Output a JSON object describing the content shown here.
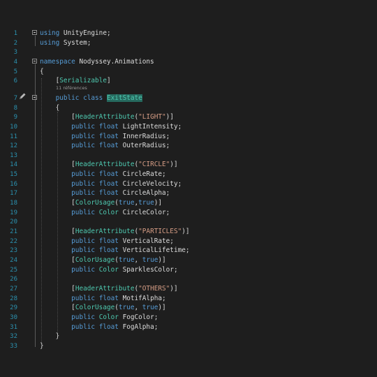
{
  "editor": {
    "references_label": "11 références",
    "lines": [
      {
        "n": "1",
        "tokens": [
          {
            "t": "using",
            "c": "kw"
          },
          {
            "t": " UnityEngine;",
            "c": "id"
          }
        ]
      },
      {
        "n": "2",
        "tokens": [
          {
            "t": "using",
            "c": "kw"
          },
          {
            "t": " System;",
            "c": "id"
          }
        ]
      },
      {
        "n": "3",
        "tokens": []
      },
      {
        "n": "4",
        "tokens": [
          {
            "t": "namespace",
            "c": "kw"
          },
          {
            "t": " Nodyssey.Animations",
            "c": "id"
          }
        ]
      },
      {
        "n": "5",
        "tokens": [
          {
            "t": "{",
            "c": "pun"
          }
        ]
      },
      {
        "n": "6",
        "tokens": [
          {
            "t": "    [",
            "c": "pun"
          },
          {
            "t": "Serializable",
            "c": "ty"
          },
          {
            "t": "]",
            "c": "pun"
          }
        ]
      },
      {
        "n": "7",
        "tokens": [
          {
            "t": "    public",
            "c": "kw"
          },
          {
            "t": " ",
            "c": "id"
          },
          {
            "t": "class",
            "c": "kw"
          },
          {
            "t": " ",
            "c": "id"
          },
          {
            "t": "ExitState",
            "c": "hl"
          }
        ]
      },
      {
        "n": "8",
        "tokens": [
          {
            "t": "    {",
            "c": "pun"
          }
        ]
      },
      {
        "n": "9",
        "tokens": [
          {
            "t": "        [",
            "c": "pun"
          },
          {
            "t": "HeaderAttribute",
            "c": "ty"
          },
          {
            "t": "(",
            "c": "pun"
          },
          {
            "t": "\"LIGHT\"",
            "c": "str"
          },
          {
            "t": ")]",
            "c": "pun"
          }
        ]
      },
      {
        "n": "10",
        "tokens": [
          {
            "t": "        public",
            "c": "kw"
          },
          {
            "t": " ",
            "c": "id"
          },
          {
            "t": "float",
            "c": "kw"
          },
          {
            "t": " LightIntensity;",
            "c": "id"
          }
        ]
      },
      {
        "n": "11",
        "tokens": [
          {
            "t": "        public",
            "c": "kw"
          },
          {
            "t": " ",
            "c": "id"
          },
          {
            "t": "float",
            "c": "kw"
          },
          {
            "t": " InnerRadius;",
            "c": "id"
          }
        ]
      },
      {
        "n": "12",
        "tokens": [
          {
            "t": "        public",
            "c": "kw"
          },
          {
            "t": " ",
            "c": "id"
          },
          {
            "t": "float",
            "c": "kw"
          },
          {
            "t": " OuterRadius;",
            "c": "id"
          }
        ]
      },
      {
        "n": "13",
        "tokens": []
      },
      {
        "n": "14",
        "tokens": [
          {
            "t": "        [",
            "c": "pun"
          },
          {
            "t": "HeaderAttribute",
            "c": "ty"
          },
          {
            "t": "(",
            "c": "pun"
          },
          {
            "t": "\"CIRCLE\"",
            "c": "str"
          },
          {
            "t": ")]",
            "c": "pun"
          }
        ]
      },
      {
        "n": "15",
        "tokens": [
          {
            "t": "        public",
            "c": "kw"
          },
          {
            "t": " ",
            "c": "id"
          },
          {
            "t": "float",
            "c": "kw"
          },
          {
            "t": " CircleRate;",
            "c": "id"
          }
        ]
      },
      {
        "n": "16",
        "tokens": [
          {
            "t": "        public",
            "c": "kw"
          },
          {
            "t": " ",
            "c": "id"
          },
          {
            "t": "float",
            "c": "kw"
          },
          {
            "t": " CircleVelocity;",
            "c": "id"
          }
        ]
      },
      {
        "n": "17",
        "tokens": [
          {
            "t": "        public",
            "c": "kw"
          },
          {
            "t": " ",
            "c": "id"
          },
          {
            "t": "float",
            "c": "kw"
          },
          {
            "t": " CircleAlpha;",
            "c": "id"
          }
        ]
      },
      {
        "n": "18",
        "tokens": [
          {
            "t": "        [",
            "c": "pun"
          },
          {
            "t": "ColorUsage",
            "c": "ty"
          },
          {
            "t": "(",
            "c": "pun"
          },
          {
            "t": "true",
            "c": "kw"
          },
          {
            "t": ",",
            "c": "pun"
          },
          {
            "t": "true",
            "c": "kw"
          },
          {
            "t": ")]",
            "c": "pun"
          }
        ]
      },
      {
        "n": "19",
        "tokens": [
          {
            "t": "        public",
            "c": "kw"
          },
          {
            "t": " ",
            "c": "id"
          },
          {
            "t": "Color",
            "c": "ty"
          },
          {
            "t": " CircleColor;",
            "c": "id"
          }
        ]
      },
      {
        "n": "20",
        "tokens": []
      },
      {
        "n": "21",
        "tokens": [
          {
            "t": "        [",
            "c": "pun"
          },
          {
            "t": "HeaderAttribute",
            "c": "ty"
          },
          {
            "t": "(",
            "c": "pun"
          },
          {
            "t": "\"PARTICLES\"",
            "c": "str"
          },
          {
            "t": ")]",
            "c": "pun"
          }
        ]
      },
      {
        "n": "22",
        "tokens": [
          {
            "t": "        public",
            "c": "kw"
          },
          {
            "t": " ",
            "c": "id"
          },
          {
            "t": "float",
            "c": "kw"
          },
          {
            "t": " VerticalRate;",
            "c": "id"
          }
        ]
      },
      {
        "n": "23",
        "tokens": [
          {
            "t": "        public",
            "c": "kw"
          },
          {
            "t": " ",
            "c": "id"
          },
          {
            "t": "float",
            "c": "kw"
          },
          {
            "t": " VerticalLifetime;",
            "c": "id"
          }
        ]
      },
      {
        "n": "24",
        "tokens": [
          {
            "t": "        [",
            "c": "pun"
          },
          {
            "t": "ColorUsage",
            "c": "ty"
          },
          {
            "t": "(",
            "c": "pun"
          },
          {
            "t": "true",
            "c": "kw"
          },
          {
            "t": ", ",
            "c": "pun"
          },
          {
            "t": "true",
            "c": "kw"
          },
          {
            "t": ")]",
            "c": "pun"
          }
        ]
      },
      {
        "n": "25",
        "tokens": [
          {
            "t": "        public",
            "c": "kw"
          },
          {
            "t": " ",
            "c": "id"
          },
          {
            "t": "Color",
            "c": "ty"
          },
          {
            "t": " SparklesColor;",
            "c": "id"
          }
        ]
      },
      {
        "n": "26",
        "tokens": []
      },
      {
        "n": "27",
        "tokens": [
          {
            "t": "        [",
            "c": "pun"
          },
          {
            "t": "HeaderAttribute",
            "c": "ty"
          },
          {
            "t": "(",
            "c": "pun"
          },
          {
            "t": "\"OTHERS\"",
            "c": "str"
          },
          {
            "t": ")]",
            "c": "pun"
          }
        ]
      },
      {
        "n": "28",
        "tokens": [
          {
            "t": "        public",
            "c": "kw"
          },
          {
            "t": " ",
            "c": "id"
          },
          {
            "t": "float",
            "c": "kw"
          },
          {
            "t": " MotifAlpha;",
            "c": "id"
          }
        ]
      },
      {
        "n": "29",
        "tokens": [
          {
            "t": "        [",
            "c": "pun"
          },
          {
            "t": "ColorUsage",
            "c": "ty"
          },
          {
            "t": "(",
            "c": "pun"
          },
          {
            "t": "true",
            "c": "kw"
          },
          {
            "t": ", ",
            "c": "pun"
          },
          {
            "t": "true",
            "c": "kw"
          },
          {
            "t": ")]",
            "c": "pun"
          }
        ]
      },
      {
        "n": "30",
        "tokens": [
          {
            "t": "        public",
            "c": "kw"
          },
          {
            "t": " ",
            "c": "id"
          },
          {
            "t": "Color",
            "c": "ty"
          },
          {
            "t": " FogColor;",
            "c": "id"
          }
        ]
      },
      {
        "n": "31",
        "tokens": [
          {
            "t": "        public",
            "c": "kw"
          },
          {
            "t": " ",
            "c": "id"
          },
          {
            "t": "float",
            "c": "kw"
          },
          {
            "t": " FogAlpha;",
            "c": "id"
          }
        ]
      },
      {
        "n": "32",
        "tokens": [
          {
            "t": "    }",
            "c": "pun"
          }
        ]
      },
      {
        "n": "33",
        "tokens": [
          {
            "t": "}",
            "c": "pun"
          }
        ]
      }
    ]
  },
  "colors": {
    "background": "#1e1e1e",
    "keyword": "#569cd6",
    "type": "#4ec9b0",
    "string": "#d69d85",
    "line_number": "#2b91af"
  },
  "icons": {
    "fold": "minus-square",
    "edit": "pencil-icon"
  }
}
